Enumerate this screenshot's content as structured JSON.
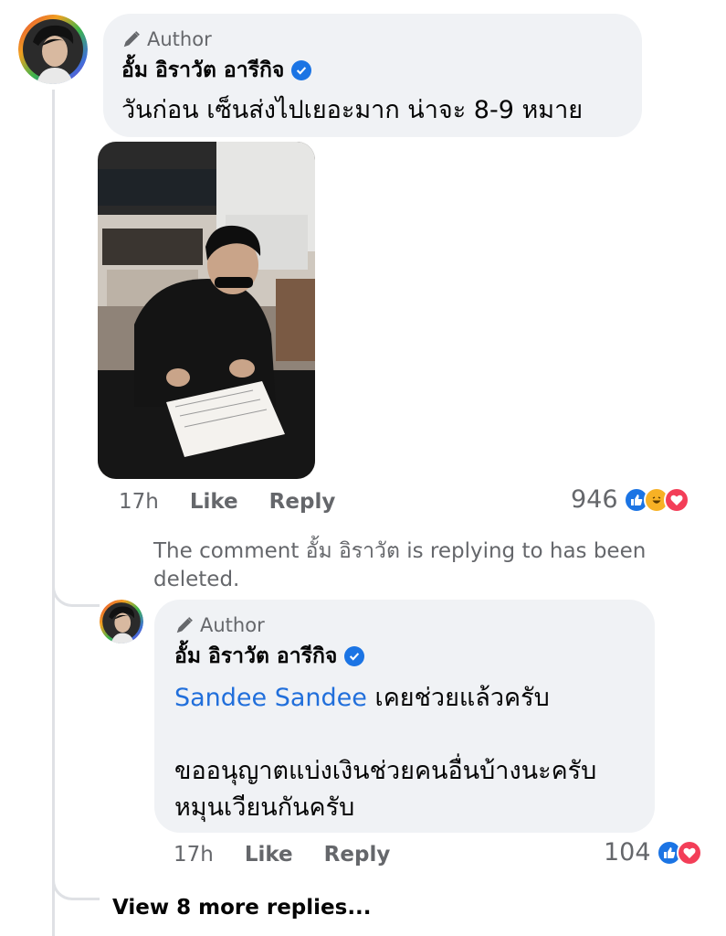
{
  "comment": {
    "badge": "Author",
    "author": "อั้ม อิราวัต อารีกิจ",
    "text": "วันก่อน เซ็นส่งไปเยอะมาก น่าจะ 8-9 หมาย",
    "time": "17h",
    "like_label": "Like",
    "reply_label": "Reply",
    "reaction_count": "946",
    "reactions": [
      "like-icon",
      "haha-icon",
      "love-icon"
    ]
  },
  "deleted_note": "The comment อั้ม อิราวัต is replying to has been deleted.",
  "reply": {
    "badge": "Author",
    "author": "อั้ม อิราวัต อารีกิจ",
    "mention": "Sandee Sandee",
    "text_line1": " เคยช่วยแล้วครับ",
    "text_para2": "ขออนุญาตแบ่งเงินช่วยคนอื่นบ้างนะครับ\nหมุนเวียนกันครับ",
    "time": "17h",
    "like_label": "Like",
    "reply_label": "Reply",
    "reaction_count": "104",
    "reactions": [
      "like-icon",
      "love-icon"
    ]
  },
  "view_more": "View 8 more replies...",
  "colors": {
    "bubble": "#f0f2f5",
    "secondary_text": "#65676b",
    "mention": "#216fdb",
    "verified": "#1b74e4"
  }
}
